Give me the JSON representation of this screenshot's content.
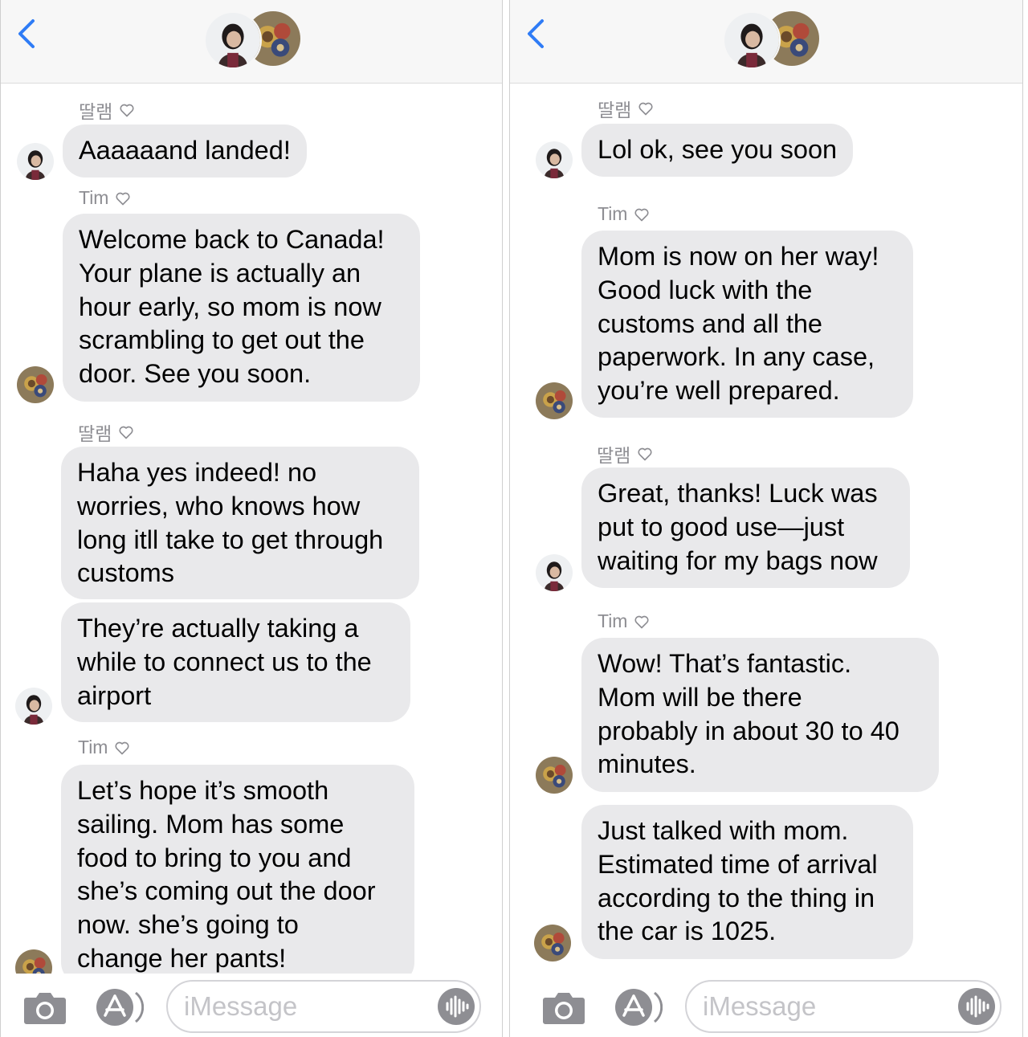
{
  "conversation": {
    "left": {
      "messages": [
        {
          "sender": "딸램",
          "text": "Aaaaaand landed!"
        },
        {
          "sender": "Tim",
          "text": "Welcome back to Canada!\nYour plane is actually an\nhour early, so mom is now\nscrambling to get out the\ndoor. See you soon."
        },
        {
          "sender": "딸램",
          "text": "Haha yes indeed! no\nworries, who knows how\nlong itll take to get through\ncustoms"
        },
        {
          "sender": "",
          "text": "They’re actually taking a\nwhile to connect us to the\nairport"
        },
        {
          "sender": "Tim",
          "text": "Let’s hope it’s smooth\nsailing. Mom has some\nfood to bring to you and\nshe’s coming out the door\nnow. she’s going to\nchange her pants!"
        }
      ]
    },
    "right": {
      "messages": [
        {
          "sender": "딸램",
          "text": "Lol ok, see you soon"
        },
        {
          "sender": "Tim",
          "text": "Mom is now on her way!\nGood luck with the\ncustoms and all the\npaperwork. In any case,\nyou’re well prepared."
        },
        {
          "sender": "딸램",
          "text": "Great, thanks! Luck was\nput to good use—just\nwaiting for my bags now"
        },
        {
          "sender": "Tim",
          "text": " Wow! That’s fantastic.\nMom will be there\nprobably in about 30 to 40\nminutes."
        },
        {
          "sender": "",
          "text": "Just talked with mom.\nEstimated time of arrival\naccording to the thing in\nthe car is 1025."
        }
      ]
    }
  },
  "composer": {
    "placeholder": "iMessage"
  },
  "colors": {
    "accent": "#2f7cf6",
    "bubble": "#e9e9eb",
    "secondary_text": "#8e8e93",
    "header_bg": "#f7f7f7"
  },
  "icons": {
    "back": "chevron-left-icon",
    "camera": "camera-icon",
    "apps": "app-store-icon",
    "audio": "waveform-icon",
    "heart": "heart-outline-icon"
  }
}
